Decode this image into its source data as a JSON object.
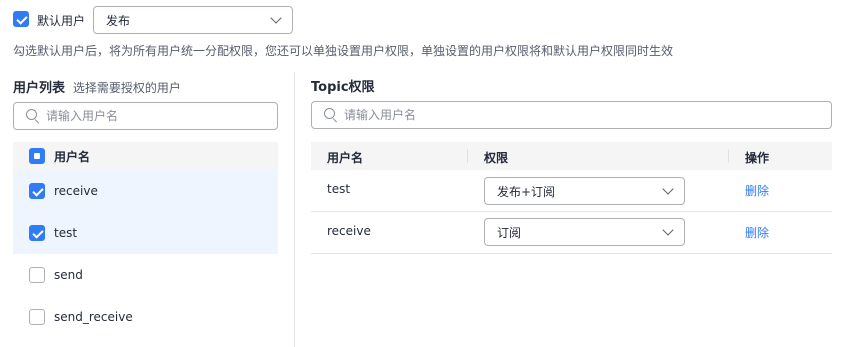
{
  "default_user": {
    "checked": true,
    "label": "默认用户",
    "select_value": "发布"
  },
  "hint": "勾选默认用户后，将为所有用户统一分配权限，您还可以单独设置用户权限，单独设置的用户权限将和默认用户权限同时生效",
  "user_list": {
    "title": "用户列表",
    "subtitle": "选择需要授权的用户",
    "search_placeholder": "请输入用户名",
    "header": "用户名",
    "users": [
      {
        "name": "receive",
        "checked": true
      },
      {
        "name": "test",
        "checked": true
      },
      {
        "name": "send",
        "checked": false
      },
      {
        "name": "send_receive",
        "checked": false
      }
    ]
  },
  "topic": {
    "title": "Topic权限",
    "search_placeholder": "请输入用户名",
    "columns": [
      "用户名",
      "权限",
      "操作"
    ],
    "rows": [
      {
        "user": "test",
        "permission": "发布+订阅",
        "action": "删除"
      },
      {
        "user": "receive",
        "permission": "订阅",
        "action": "删除"
      }
    ]
  },
  "colors": {
    "accent": "#2f7cf6",
    "selected_row_bg": "#eef5fe"
  }
}
